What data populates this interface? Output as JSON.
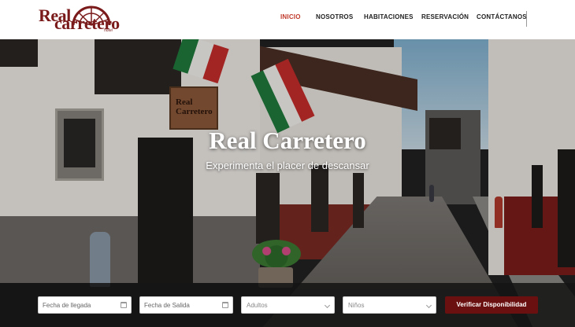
{
  "brand": {
    "logo_word1": "Real",
    "logo_word2": "carretero",
    "logo_sub": "hotel",
    "primary_color": "#7a1a1a",
    "accent_color": "#c0392b"
  },
  "nav": {
    "items": [
      {
        "label": "INICIO",
        "active": true
      },
      {
        "label": "NOSOTROS",
        "active": false
      },
      {
        "label": "HABITACIONES",
        "active": false
      },
      {
        "label": "RESERVACIÓN",
        "active": false
      },
      {
        "label": "CONTÁCTANOS",
        "active": false
      }
    ]
  },
  "hero": {
    "title": "Real Carretero",
    "subtitle": "Experimenta el placer de descansar",
    "sign_text": "Real Carretero"
  },
  "booking": {
    "checkin_placeholder": "Fecha de llegada",
    "checkout_placeholder": "Fecha de Salida",
    "adults_label": "Adultos",
    "children_label": "Niños",
    "submit_label": "Verificar Disponibilidad",
    "button_color": "#6b1010"
  }
}
